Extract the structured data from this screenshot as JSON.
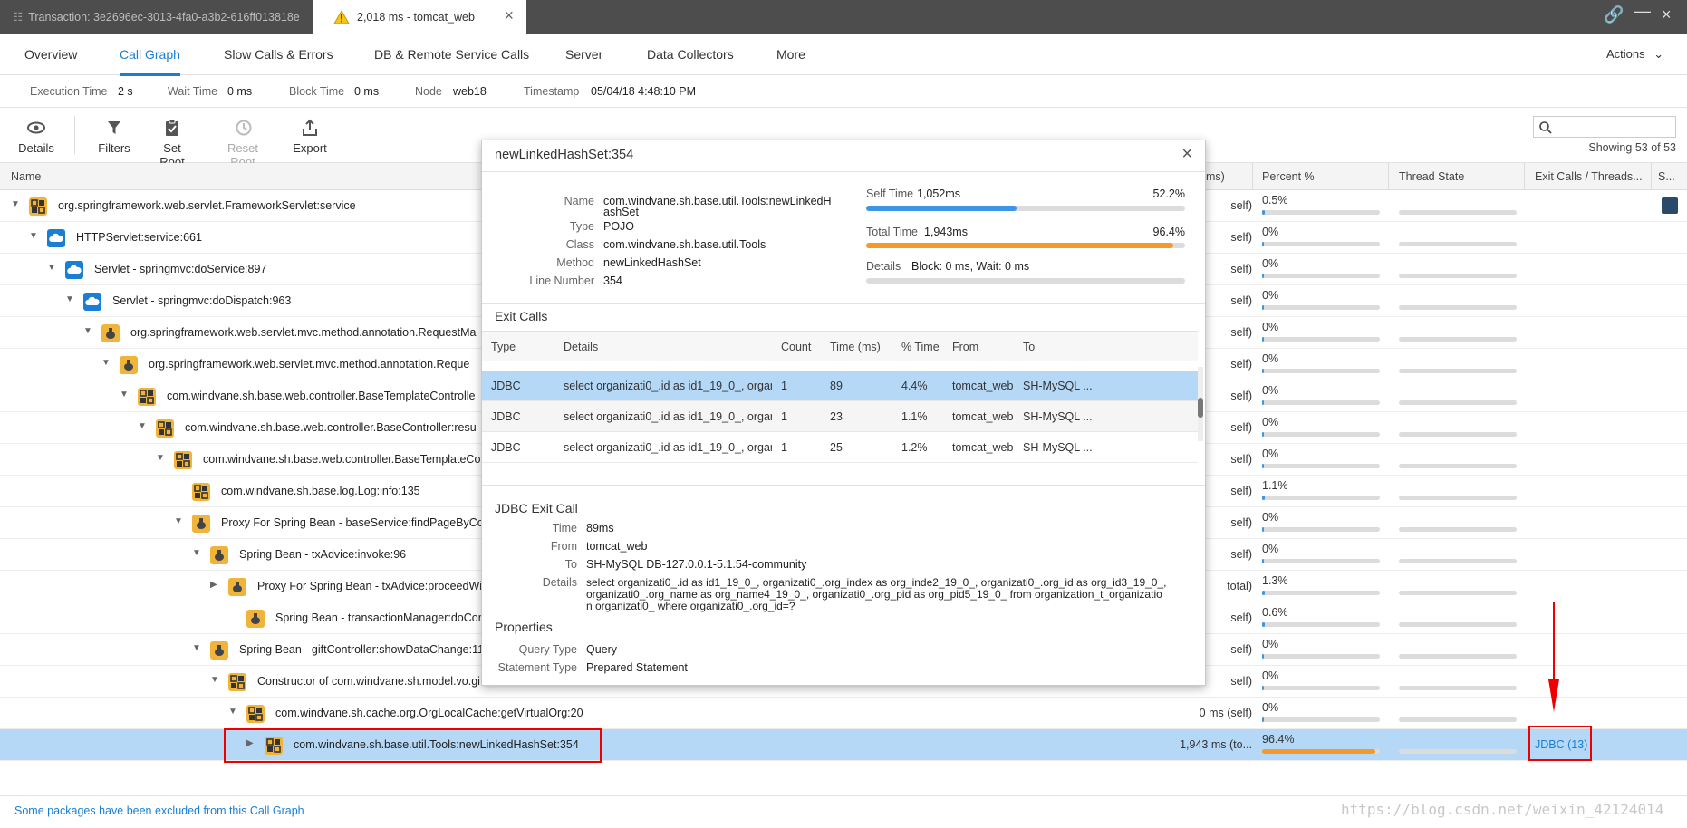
{
  "window": {
    "tab1_title": "Transaction: 3e2696ec-3013-4fa0-a3b2-616ff013818e",
    "tab2_title": "2,018 ms - tomcat_web"
  },
  "nav": {
    "tabs": [
      "Overview",
      "Call Graph",
      "Slow Calls & Errors",
      "DB & Remote Service Calls",
      "Server",
      "Data Collectors",
      "More"
    ],
    "actions": "Actions"
  },
  "info": {
    "execution_time_label": "Execution Time",
    "execution_time": "2 s",
    "wait_time_label": "Wait Time",
    "wait_time": "0 ms",
    "block_time_label": "Block Time",
    "block_time": "0 ms",
    "node_label": "Node",
    "node": "web18",
    "timestamp_label": "Timestamp",
    "timestamp": "05/04/18 4:48:10 PM"
  },
  "toolbar": {
    "details": "Details",
    "filters": "Filters",
    "set_root": "Set Root",
    "reset_root": "Reset Root",
    "export": "Export",
    "showing": "Showing 53 of 53"
  },
  "table": {
    "headers": {
      "name": "Name",
      "time_partial": "ms)",
      "percent": "Percent %",
      "thread_state": "Thread State",
      "exit_calls": "Exit Calls / Threads...",
      "s": "S..."
    },
    "rows": [
      {
        "name": "org.springframework.web.servlet.FrameworkServlet:service",
        "time": "self)",
        "percent": "0.5%",
        "pct": 0.5
      },
      {
        "name": "HTTPServlet:service:661",
        "time": "self)",
        "percent": "0%",
        "pct": 0
      },
      {
        "name": "Servlet - springmvc:doService:897",
        "time": "self)",
        "percent": "0%",
        "pct": 0
      },
      {
        "name": "Servlet - springmvc:doDispatch:963",
        "time": "self)",
        "percent": "0%",
        "pct": 0
      },
      {
        "name": "org.springframework.web.servlet.mvc.method.annotation.RequestMa",
        "time": "self)",
        "percent": "0%",
        "pct": 0
      },
      {
        "name": "org.springframework.web.servlet.mvc.method.annotation.Reque",
        "time": "self)",
        "percent": "0%",
        "pct": 0
      },
      {
        "name": "com.windvane.sh.base.web.controller.BaseTemplateControlle",
        "time": "self)",
        "percent": "0%",
        "pct": 0
      },
      {
        "name": "com.windvane.sh.base.web.controller.BaseController:resu",
        "time": "self)",
        "percent": "0%",
        "pct": 0
      },
      {
        "name": "com.windvane.sh.base.web.controller.BaseTemplateCo",
        "time": "self)",
        "percent": "0%",
        "pct": 0
      },
      {
        "name": "com.windvane.sh.base.log.Log:info:135",
        "time": "self)",
        "percent": "1.1%",
        "pct": 1.1
      },
      {
        "name": "Proxy For Spring Bean - baseService:findPageByCo",
        "time": "self)",
        "percent": "0%",
        "pct": 0
      },
      {
        "name": "Spring Bean - txAdvice:invoke:96",
        "time": "self)",
        "percent": "0%",
        "pct": 0
      },
      {
        "name": "Proxy For Spring Bean - txAdvice:proceedWi",
        "time": "total)",
        "percent": "1.3%",
        "pct": 1.3
      },
      {
        "name": "Spring Bean - transactionManager:doComm",
        "time": "self)",
        "percent": "0.6%",
        "pct": 0.6
      },
      {
        "name": "Spring Bean - giftController:showDataChange:110",
        "time": "self)",
        "percent": "0%",
        "pct": 0
      },
      {
        "name": "Constructor of com.windvane.sh.model.vo.gift.C",
        "time": "self)",
        "percent": "0%",
        "pct": 0
      },
      {
        "name": "com.windvane.sh.cache.org.OrgLocalCache:getVirtualOrg:20",
        "time": "0 ms (self)",
        "percent": "0%",
        "pct": 0
      },
      {
        "name": "com.windvane.sh.base.util.Tools:newLinkedHashSet:354",
        "time": "1,943 ms (to...",
        "percent": "96.4%",
        "pct": 96.4,
        "exit_calls": "JDBC (13)"
      }
    ]
  },
  "popup": {
    "title": "newLinkedHashSet:354",
    "name_label": "Name",
    "name_line1": "com.windvane.sh.base.util.Tools:newLinkedH",
    "name_line2": "ashSet",
    "type_label": "Type",
    "type": "POJO",
    "class_label": "Class",
    "class": "com.windvane.sh.base.util.Tools",
    "method_label": "Method",
    "method": "newLinkedHashSet",
    "line_label": "Line Number",
    "line": "354",
    "self_time_label": "Self Time",
    "self_time": "1,052ms",
    "self_pct": "52.2%",
    "self_frac": 0.522,
    "total_time_label": "Total Time",
    "total_time": "1,943ms",
    "total_pct": "96.4%",
    "total_frac": 0.964,
    "details_label": "Details",
    "details": "Block: 0 ms, Wait: 0 ms",
    "exit_calls_title": "Exit Calls",
    "exit_headers": [
      "Type",
      "Details",
      "Count",
      "Time (ms)",
      "% Time",
      "From",
      "To"
    ],
    "exit_rows": [
      {
        "type": "JDBC",
        "details": "select organizati0_.id as id1_19_0_, organizati...",
        "count": "1",
        "time": "89",
        "pct": "4.4%",
        "from": "tomcat_web",
        "to": "SH-MySQL ..."
      },
      {
        "type": "JDBC",
        "details": "select organizati0_.id as id1_19_0_, organizati...",
        "count": "1",
        "time": "23",
        "pct": "1.1%",
        "from": "tomcat_web",
        "to": "SH-MySQL ..."
      },
      {
        "type": "JDBC",
        "details": "select organizati0_.id as id1_19_0_, organizati...",
        "count": "1",
        "time": "25",
        "pct": "1.2%",
        "from": "tomcat_web",
        "to": "SH-MySQL ..."
      }
    ],
    "jdbc_title": "JDBC Exit Call",
    "jdbc_time_label": "Time",
    "jdbc_time": "89ms",
    "jdbc_from_label": "From",
    "jdbc_from": "tomcat_web",
    "jdbc_to_label": "To",
    "jdbc_to": "SH-MySQL DB-127.0.0.1-5.1.54-community",
    "jdbc_details_label": "Details",
    "jdbc_details_1": "select organizati0_.id as id1_19_0_, organizati0_.org_index as org_inde2_19_0_, organizati0_.org_id as org_id3_19_0_,",
    "jdbc_details_2": "organizati0_.org_name as org_name4_19_0_, organizati0_.org_pid as org_pid5_19_0_ from organization_t_organizatio",
    "jdbc_details_3": "n organizati0_ where organizati0_.org_id=?",
    "props_title": "Properties",
    "query_type_label": "Query Type",
    "query_type": "Query",
    "stmt_type_label": "Statement Type",
    "stmt_type": "Prepared Statement"
  },
  "footer": {
    "text": "Some packages have been excluded from this Call Graph"
  },
  "watermark": "https://blog.csdn.net/weixin_42124014",
  "colors": {
    "accent": "#1a7fd4",
    "selected_row": "#b5d8f7",
    "self_bar": "#3d95e6",
    "total_bar": "#f39a2b",
    "highlight": "#e00000"
  }
}
